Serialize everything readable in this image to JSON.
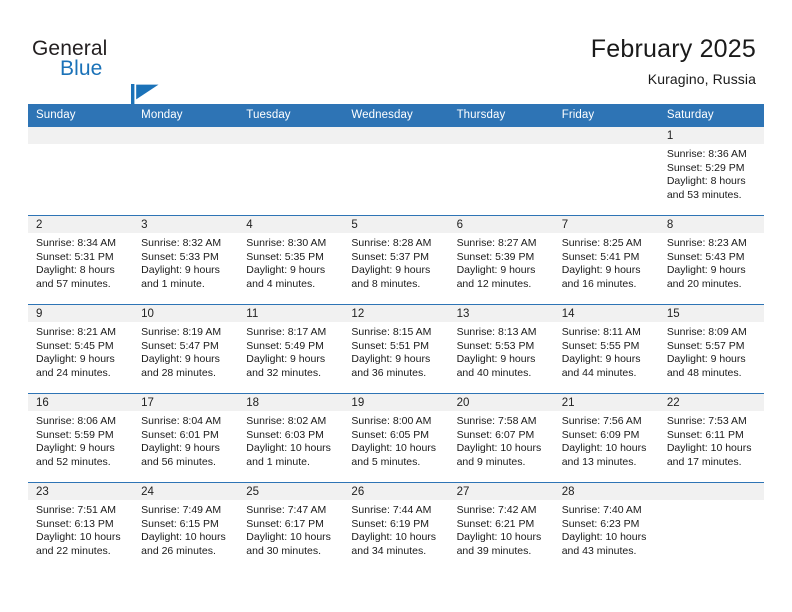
{
  "brand": {
    "word_one": "General",
    "word_two": "Blue",
    "mark": "triangle-flag-icon",
    "colors": {
      "text_dark": "#231f20",
      "accent_blue": "#1b72b8"
    }
  },
  "header": {
    "title": "February 2025",
    "subtitle": "Kuragino, Russia"
  },
  "colors": {
    "header_row_background": "#2e74b5",
    "header_row_text": "#ffffff",
    "day_number_band": "#f1f1f1",
    "cell_background": "#ffffff",
    "row_divider": "#2e74b5"
  },
  "calendar": {
    "weekday_headers": [
      "Sunday",
      "Monday",
      "Tuesday",
      "Wednesday",
      "Thursday",
      "Friday",
      "Saturday"
    ],
    "weeks": [
      [
        {
          "day": "",
          "empty": true
        },
        {
          "day": "",
          "empty": true
        },
        {
          "day": "",
          "empty": true
        },
        {
          "day": "",
          "empty": true
        },
        {
          "day": "",
          "empty": true
        },
        {
          "day": "",
          "empty": true
        },
        {
          "day": "1",
          "sunrise": "Sunrise: 8:36 AM",
          "sunset": "Sunset: 5:29 PM",
          "daylight_line1": "Daylight: 8 hours",
          "daylight_line2": "and 53 minutes."
        }
      ],
      [
        {
          "day": "2",
          "sunrise": "Sunrise: 8:34 AM",
          "sunset": "Sunset: 5:31 PM",
          "daylight_line1": "Daylight: 8 hours",
          "daylight_line2": "and 57 minutes."
        },
        {
          "day": "3",
          "sunrise": "Sunrise: 8:32 AM",
          "sunset": "Sunset: 5:33 PM",
          "daylight_line1": "Daylight: 9 hours",
          "daylight_line2": "and 1 minute."
        },
        {
          "day": "4",
          "sunrise": "Sunrise: 8:30 AM",
          "sunset": "Sunset: 5:35 PM",
          "daylight_line1": "Daylight: 9 hours",
          "daylight_line2": "and 4 minutes."
        },
        {
          "day": "5",
          "sunrise": "Sunrise: 8:28 AM",
          "sunset": "Sunset: 5:37 PM",
          "daylight_line1": "Daylight: 9 hours",
          "daylight_line2": "and 8 minutes."
        },
        {
          "day": "6",
          "sunrise": "Sunrise: 8:27 AM",
          "sunset": "Sunset: 5:39 PM",
          "daylight_line1": "Daylight: 9 hours",
          "daylight_line2": "and 12 minutes."
        },
        {
          "day": "7",
          "sunrise": "Sunrise: 8:25 AM",
          "sunset": "Sunset: 5:41 PM",
          "daylight_line1": "Daylight: 9 hours",
          "daylight_line2": "and 16 minutes."
        },
        {
          "day": "8",
          "sunrise": "Sunrise: 8:23 AM",
          "sunset": "Sunset: 5:43 PM",
          "daylight_line1": "Daylight: 9 hours",
          "daylight_line2": "and 20 minutes."
        }
      ],
      [
        {
          "day": "9",
          "sunrise": "Sunrise: 8:21 AM",
          "sunset": "Sunset: 5:45 PM",
          "daylight_line1": "Daylight: 9 hours",
          "daylight_line2": "and 24 minutes."
        },
        {
          "day": "10",
          "sunrise": "Sunrise: 8:19 AM",
          "sunset": "Sunset: 5:47 PM",
          "daylight_line1": "Daylight: 9 hours",
          "daylight_line2": "and 28 minutes."
        },
        {
          "day": "11",
          "sunrise": "Sunrise: 8:17 AM",
          "sunset": "Sunset: 5:49 PM",
          "daylight_line1": "Daylight: 9 hours",
          "daylight_line2": "and 32 minutes."
        },
        {
          "day": "12",
          "sunrise": "Sunrise: 8:15 AM",
          "sunset": "Sunset: 5:51 PM",
          "daylight_line1": "Daylight: 9 hours",
          "daylight_line2": "and 36 minutes."
        },
        {
          "day": "13",
          "sunrise": "Sunrise: 8:13 AM",
          "sunset": "Sunset: 5:53 PM",
          "daylight_line1": "Daylight: 9 hours",
          "daylight_line2": "and 40 minutes."
        },
        {
          "day": "14",
          "sunrise": "Sunrise: 8:11 AM",
          "sunset": "Sunset: 5:55 PM",
          "daylight_line1": "Daylight: 9 hours",
          "daylight_line2": "and 44 minutes."
        },
        {
          "day": "15",
          "sunrise": "Sunrise: 8:09 AM",
          "sunset": "Sunset: 5:57 PM",
          "daylight_line1": "Daylight: 9 hours",
          "daylight_line2": "and 48 minutes."
        }
      ],
      [
        {
          "day": "16",
          "sunrise": "Sunrise: 8:06 AM",
          "sunset": "Sunset: 5:59 PM",
          "daylight_line1": "Daylight: 9 hours",
          "daylight_line2": "and 52 minutes."
        },
        {
          "day": "17",
          "sunrise": "Sunrise: 8:04 AM",
          "sunset": "Sunset: 6:01 PM",
          "daylight_line1": "Daylight: 9 hours",
          "daylight_line2": "and 56 minutes."
        },
        {
          "day": "18",
          "sunrise": "Sunrise: 8:02 AM",
          "sunset": "Sunset: 6:03 PM",
          "daylight_line1": "Daylight: 10 hours",
          "daylight_line2": "and 1 minute."
        },
        {
          "day": "19",
          "sunrise": "Sunrise: 8:00 AM",
          "sunset": "Sunset: 6:05 PM",
          "daylight_line1": "Daylight: 10 hours",
          "daylight_line2": "and 5 minutes."
        },
        {
          "day": "20",
          "sunrise": "Sunrise: 7:58 AM",
          "sunset": "Sunset: 6:07 PM",
          "daylight_line1": "Daylight: 10 hours",
          "daylight_line2": "and 9 minutes."
        },
        {
          "day": "21",
          "sunrise": "Sunrise: 7:56 AM",
          "sunset": "Sunset: 6:09 PM",
          "daylight_line1": "Daylight: 10 hours",
          "daylight_line2": "and 13 minutes."
        },
        {
          "day": "22",
          "sunrise": "Sunrise: 7:53 AM",
          "sunset": "Sunset: 6:11 PM",
          "daylight_line1": "Daylight: 10 hours",
          "daylight_line2": "and 17 minutes."
        }
      ],
      [
        {
          "day": "23",
          "sunrise": "Sunrise: 7:51 AM",
          "sunset": "Sunset: 6:13 PM",
          "daylight_line1": "Daylight: 10 hours",
          "daylight_line2": "and 22 minutes."
        },
        {
          "day": "24",
          "sunrise": "Sunrise: 7:49 AM",
          "sunset": "Sunset: 6:15 PM",
          "daylight_line1": "Daylight: 10 hours",
          "daylight_line2": "and 26 minutes."
        },
        {
          "day": "25",
          "sunrise": "Sunrise: 7:47 AM",
          "sunset": "Sunset: 6:17 PM",
          "daylight_line1": "Daylight: 10 hours",
          "daylight_line2": "and 30 minutes."
        },
        {
          "day": "26",
          "sunrise": "Sunrise: 7:44 AM",
          "sunset": "Sunset: 6:19 PM",
          "daylight_line1": "Daylight: 10 hours",
          "daylight_line2": "and 34 minutes."
        },
        {
          "day": "27",
          "sunrise": "Sunrise: 7:42 AM",
          "sunset": "Sunset: 6:21 PM",
          "daylight_line1": "Daylight: 10 hours",
          "daylight_line2": "and 39 minutes."
        },
        {
          "day": "28",
          "sunrise": "Sunrise: 7:40 AM",
          "sunset": "Sunset: 6:23 PM",
          "daylight_line1": "Daylight: 10 hours",
          "daylight_line2": "and 43 minutes."
        },
        {
          "day": "",
          "empty": true
        }
      ]
    ]
  }
}
